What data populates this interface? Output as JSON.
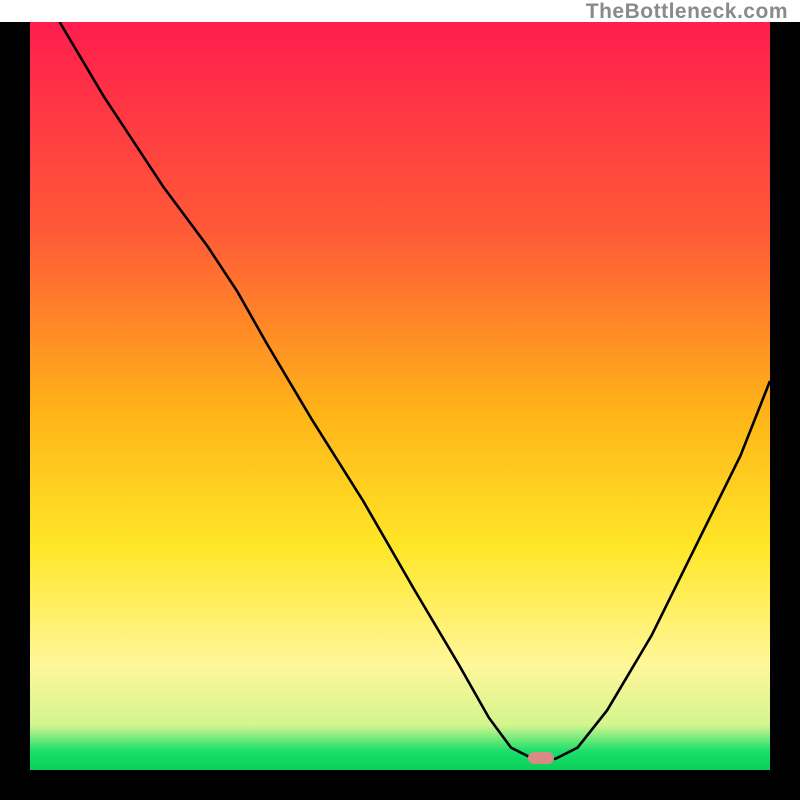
{
  "watermark": "TheBottleneck.com",
  "colors": {
    "frame": "#000000",
    "curve": "#000000",
    "marker": "#d88a84",
    "grad_top": "#ff1d4d",
    "grad_mid_upper": "#ff7a2f",
    "grad_mid": "#ffd400",
    "grad_lower": "#fff79a",
    "grad_green": "#18e06a"
  },
  "marker": {
    "x_norm": 0.677,
    "y_norm": 0.984
  },
  "chart_data": {
    "type": "line",
    "title": "",
    "xlabel": "",
    "ylabel": "",
    "xlim": [
      0,
      100
    ],
    "ylim": [
      0,
      100
    ],
    "series": [
      {
        "name": "bottleneck-curve",
        "x": [
          4,
          10,
          18,
          24,
          28,
          32,
          38,
          45,
          52,
          58,
          62,
          65,
          68,
          71,
          74,
          78,
          84,
          90,
          96,
          100
        ],
        "y": [
          100,
          90,
          78,
          70,
          64,
          57,
          47,
          36,
          24,
          14,
          7,
          3,
          1.5,
          1.5,
          3,
          8,
          18,
          30,
          42,
          52
        ]
      }
    ],
    "annotations": [
      {
        "name": "minimum-marker",
        "x": 69,
        "y": 1.6
      }
    ],
    "gradient_stops": [
      {
        "offset": 0.0,
        "color": "#ff1d4d"
      },
      {
        "offset": 0.28,
        "color": "#ff5a37"
      },
      {
        "offset": 0.52,
        "color": "#ffb318"
      },
      {
        "offset": 0.7,
        "color": "#ffe627"
      },
      {
        "offset": 0.86,
        "color": "#fff79a"
      },
      {
        "offset": 0.94,
        "color": "#d3f58e"
      },
      {
        "offset": 0.975,
        "color": "#18e06a"
      },
      {
        "offset": 1.0,
        "color": "#0ccf59"
      }
    ]
  }
}
